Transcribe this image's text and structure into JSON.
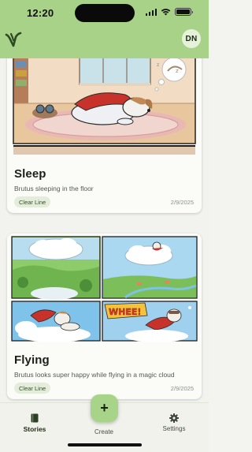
{
  "status_bar": {
    "time": "12:20",
    "icons": [
      "signal-icon",
      "wifi-icon",
      "battery-icon"
    ]
  },
  "app_bar": {
    "logo_icon": "app-logo",
    "avatar_initials": "DN",
    "background": "#a8d287"
  },
  "stories": [
    {
      "title": "Sleep",
      "description": "Brutus sleeping in the floor",
      "style": "Clear Line",
      "date": "2/9/2025"
    },
    {
      "title": "Flying",
      "description": "Brutus looks super happy while flying in a magic cloud",
      "style": "Clear Line",
      "date": "2/9/2025",
      "comic_text": "WHEE!"
    }
  ],
  "tab_bar": {
    "tabs": [
      {
        "label": "Stories",
        "icon": "book-icon",
        "active": true
      },
      {
        "label": "Create",
        "icon": "plus-icon",
        "active": false
      },
      {
        "label": "Settings",
        "icon": "gear-icon",
        "active": false
      }
    ],
    "accent": "#a7d488"
  }
}
